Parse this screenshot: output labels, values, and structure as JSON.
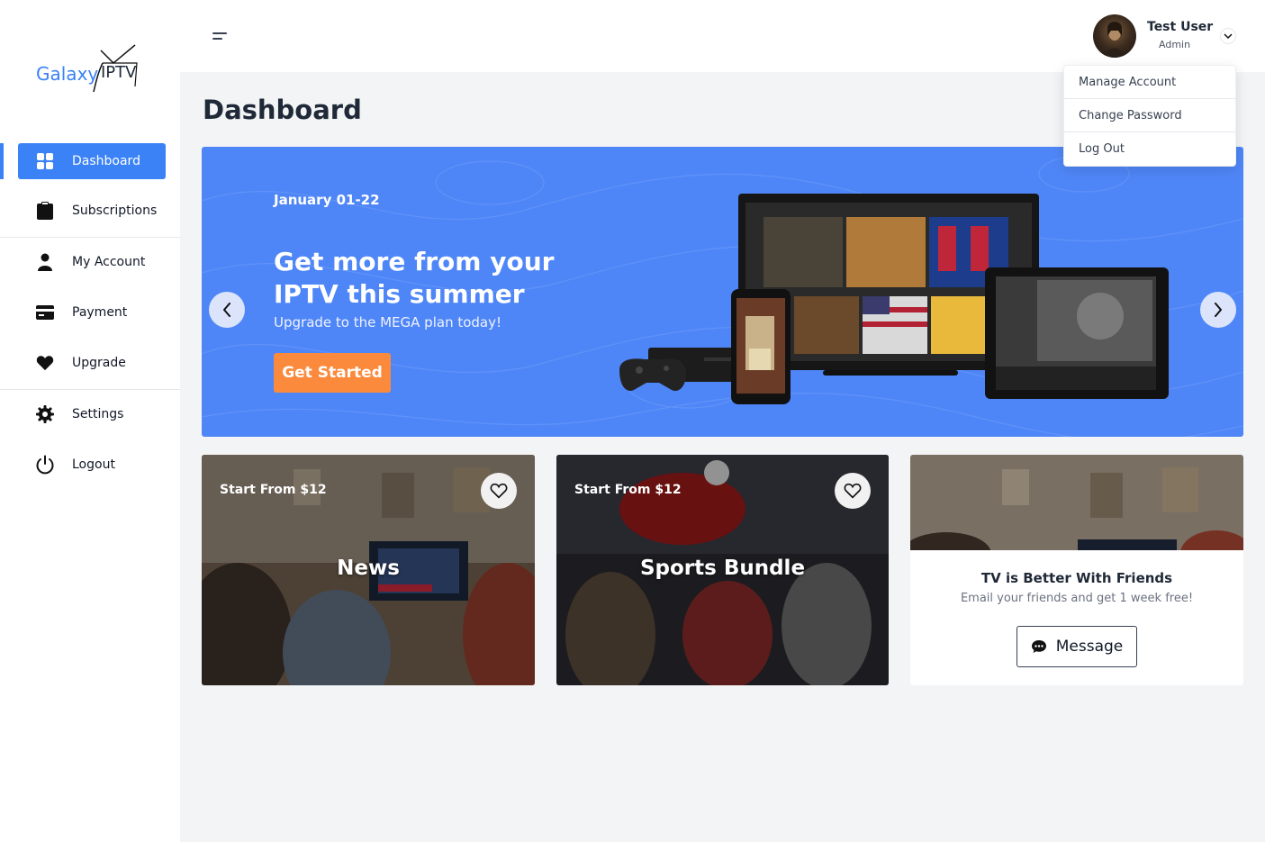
{
  "brand": {
    "name_part1": "Galaxy",
    "name_part2": "IPTV"
  },
  "sidebar": {
    "items": [
      {
        "label": "Dashboard",
        "icon": "grid-icon",
        "active": true
      },
      {
        "label": "Subscriptions",
        "icon": "clipboard-icon"
      },
      {
        "label": "My Account",
        "icon": "user-icon"
      },
      {
        "label": "Payment",
        "icon": "credit-card-icon"
      },
      {
        "label": "Upgrade",
        "icon": "heart-icon"
      },
      {
        "label": "Settings",
        "icon": "gear-icon"
      },
      {
        "label": "Logout",
        "icon": "power-icon"
      }
    ]
  },
  "header": {
    "user_name": "Test User",
    "user_role": "Admin"
  },
  "dropdown": {
    "items": [
      "Manage Account",
      "Change Password",
      "Log Out"
    ]
  },
  "page": {
    "title": "Dashboard"
  },
  "banner": {
    "date": "January 01-22",
    "title": "Get more from your IPTV this summer",
    "subtitle": "Upgrade to the MEGA plan today!",
    "cta": "Get Started"
  },
  "cards": [
    {
      "price": "Start From $12",
      "title": "News"
    },
    {
      "price": "Start From $12",
      "title": "Sports Bundle"
    }
  ],
  "friends": {
    "title": "TV is Better With Friends",
    "subtitle": "Email your friends and get 1 week free!",
    "button": "Message"
  },
  "colors": {
    "primary": "#3b82f6",
    "banner": "#4f86f7",
    "cta": "#fb8a3c"
  }
}
